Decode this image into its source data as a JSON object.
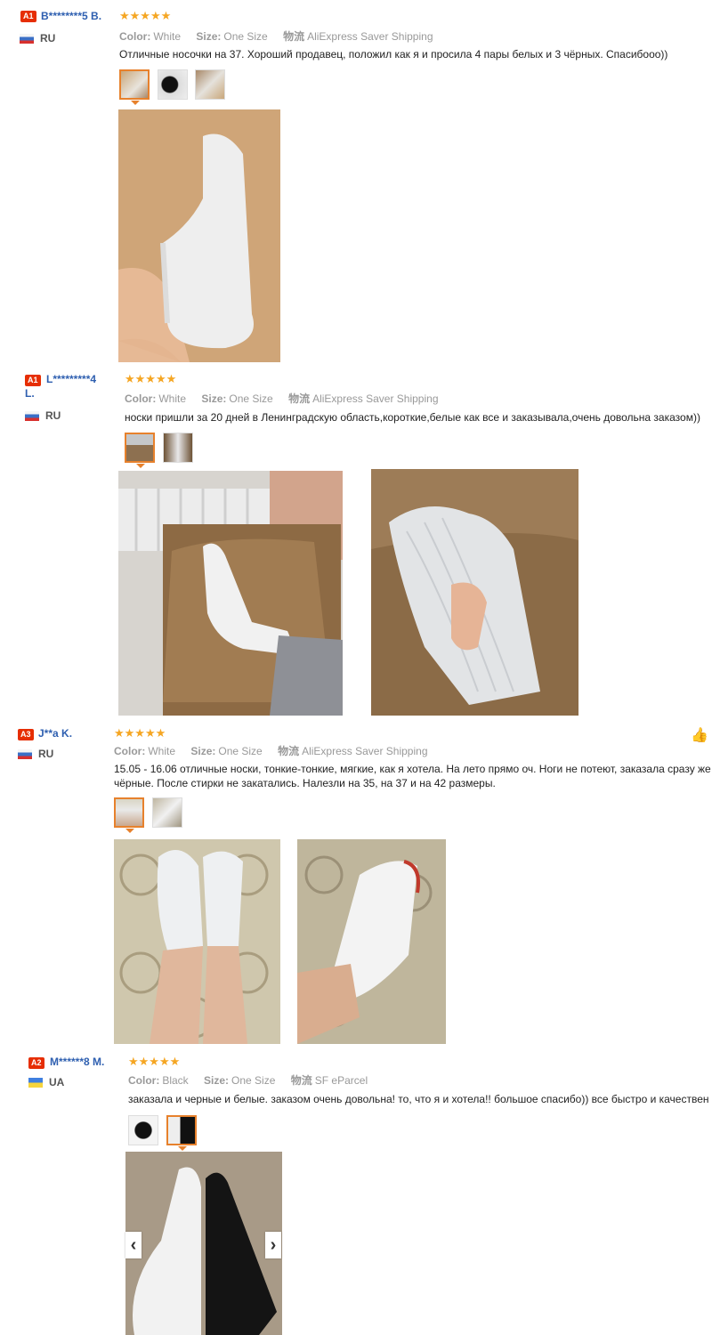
{
  "reviews": [
    {
      "badge": "A1",
      "name": "B********5 B.",
      "country": "RU",
      "stars": "★★★★★",
      "color_label": "Color:",
      "color_value": "White",
      "size_label": "Size:",
      "size_value": "One Size",
      "ship_label": "物流",
      "ship_value": "AliExpress Saver Shipping",
      "text": "Отличные носочки на 37. Хороший продавец, положил как я и просила 4 пары белых и 3 чёрных. Спасибооо))"
    },
    {
      "badge": "A1",
      "name": "L*********4",
      "name2": "L.",
      "country": "RU",
      "stars": "★★★★★",
      "color_label": "Color:",
      "color_value": "White",
      "size_label": "Size:",
      "size_value": "One Size",
      "ship_label": "物流",
      "ship_value": "AliExpress Saver Shipping",
      "text": "носки пришли за 20 дней в Ленинградскую область,короткие,белые как все и заказывала,очень довольна заказом))"
    },
    {
      "badge": "A3",
      "name": "J**a K.",
      "country": "RU",
      "stars": "★★★★★",
      "color_label": "Color:",
      "color_value": "White",
      "size_label": "Size:",
      "size_value": "One Size",
      "ship_label": "物流",
      "ship_value": "AliExpress Saver Shipping",
      "text": "15.05 - 16.06 отличные носки, тонкие-тонкие, мягкие, как я хотела. На лето прямо оч. Ноги не потеют, заказала сразу же eu",
      "text2": "чёрные. После стирки не закатались. Налезли на 35, на 37 и на 42 размеры."
    },
    {
      "badge": "A2",
      "name": "M******8 M.",
      "country": "UA",
      "stars": "★★★★★",
      "color_label": "Color:",
      "color_value": "Black",
      "size_label": "Size:",
      "size_value": "One Size",
      "ship_label": "物流",
      "ship_value": "SF eParcel",
      "text": "заказала и черные и белые. заказом очень довольна! то, что я и хотела!! большое спасибо)) все быстро и качествен"
    }
  ],
  "colors": {
    "accent": "#e7812c",
    "badge": "#e62e04",
    "name": "#2e5fb0",
    "star": "#f5a623"
  }
}
